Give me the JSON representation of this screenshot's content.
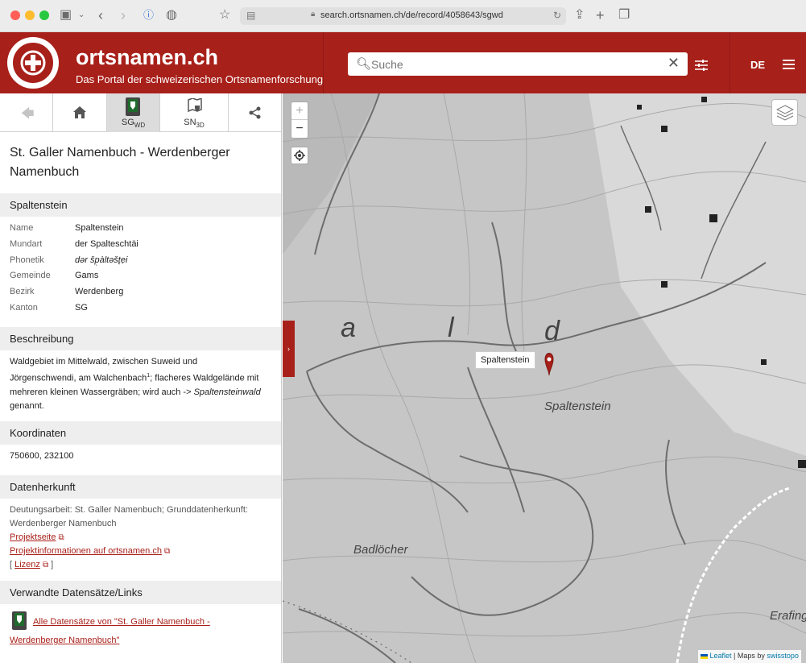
{
  "browser": {
    "url": "search.ortsnamen.ch/de/record/4058643/sgwd"
  },
  "header": {
    "title": "ortsnamen.ch",
    "subtitle": "Das Portal der schweizerischen Ortsnamenforschung",
    "search_placeholder": "Suche",
    "language": "DE"
  },
  "tabs": {
    "sg": "SG",
    "sg_sub": "WD",
    "sn": "SN",
    "sn_sub": "3D"
  },
  "record": {
    "title": "St. Galler Namenbuch - Werdenberger Namenbuch",
    "name_heading": "Spaltenstein",
    "fields": [
      {
        "k": "Name",
        "v": "Spaltenstein"
      },
      {
        "k": "Mundart",
        "v": "der Spalteschtäi"
      },
      {
        "k": "Phonetik",
        "v": "dər šp̣àltəšt̨ẹi"
      },
      {
        "k": "Gemeinde",
        "v": "Gams"
      },
      {
        "k": "Bezirk",
        "v": "Werdenberg"
      },
      {
        "k": "Kanton",
        "v": "SG"
      }
    ],
    "description_heading": "Beschreibung",
    "description_1": "Waldgebiet im Mittelwald, zwischen Suweid und",
    "description_2a": "Jörgenschwendi, am Walchenbach",
    "description_2sup": "1",
    "description_2b": "; flacheres Waldgelände mit",
    "description_3a": "mehreren kleinen Wassergräben; wird auch -> ",
    "description_3b": "Spaltensteinwald",
    "description_4": "genannt.",
    "coords_heading": "Koordinaten",
    "coords": "750600, 232100",
    "source_heading": "Datenherkunft",
    "source_1": "Deutungsarbeit: St. Galler Namenbuch; Grunddatenherkunft:",
    "source_2": "Werdenberger Namenbuch",
    "link_projekt": "Projektseite",
    "link_info": "Projektinformationen auf ortsnamen.ch",
    "link_lizenz": "Lizenz",
    "related_heading": "Verwandte Datensätze/Links",
    "related_1": "Alle Datensätze von \"St. Galler Namenbuch -",
    "related_2": "Werdenberger Namenbuch\""
  },
  "map": {
    "popup": "Spaltenstein",
    "label_a": "a",
    "label_l": "l",
    "label_d": "d",
    "label_spaltenstein": "Spaltenstein",
    "label_badloecher": "Badlöcher",
    "label_erafing": "Erafing",
    "attrib_leaflet": "Leaflet",
    "attrib_maps": " | Maps by ",
    "attrib_swisstopo": "swisstopo"
  }
}
